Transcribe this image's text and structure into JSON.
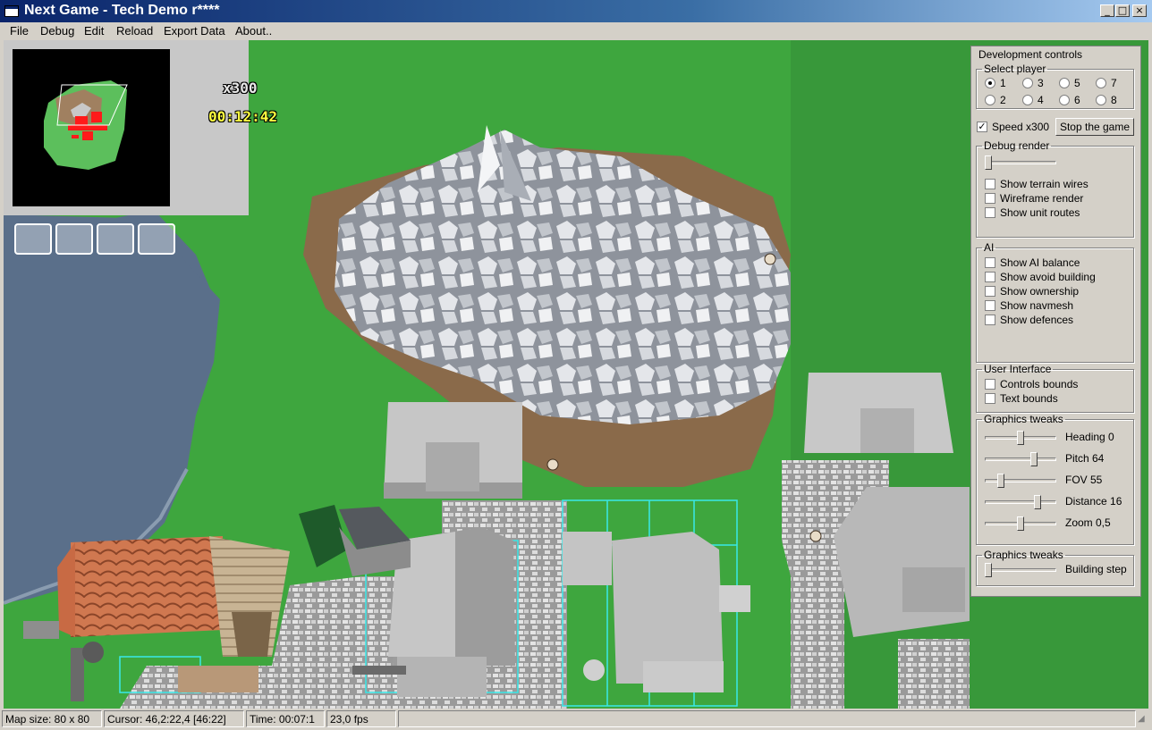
{
  "window": {
    "title": "Next Game - Tech Demo r****",
    "minimize": "_",
    "maximize": "□",
    "close": "×"
  },
  "menu": {
    "items": [
      "File",
      "Debug",
      "Edit",
      "Reload",
      "Export Data",
      "About.."
    ]
  },
  "hud": {
    "speed": "x300",
    "clock": "00:12:42"
  },
  "dev": {
    "title": "Development controls",
    "select_player": {
      "label": "Select player",
      "options": [
        "1",
        "2",
        "3",
        "4",
        "5",
        "6",
        "7",
        "8"
      ],
      "selected": "1"
    },
    "speed": {
      "label": "Speed x300",
      "checked": true
    },
    "stop_button": "Stop the game",
    "debug_render": {
      "label": "Debug render",
      "level": 0,
      "checks": [
        "Show terrain wires",
        "Wireframe render",
        "Show unit routes"
      ]
    },
    "ai": {
      "label": "AI",
      "checks": [
        "Show AI balance",
        "Show avoid building",
        "Show ownership",
        "Show navmesh",
        "Show defences"
      ]
    },
    "ui": {
      "label": "User Interface",
      "checks": [
        "Controls bounds",
        "Text bounds"
      ]
    },
    "graphics": {
      "label": "Graphics tweaks",
      "sliders": [
        {
          "label": "Heading 0",
          "level": 0.5
        },
        {
          "label": "Pitch 64",
          "level": 0.71
        },
        {
          "label": "FOV 55",
          "level": 0.19
        },
        {
          "label": "Distance 16",
          "level": 0.76
        },
        {
          "label": "Zoom 0,5",
          "level": 0.5
        }
      ]
    },
    "graphics2": {
      "label": "Graphics tweaks",
      "slider_label": "Building step",
      "level": 0
    }
  },
  "status": {
    "map": "Map size: 80 x 80",
    "cursor": "Cursor: 46,2:22,4 [46:22]",
    "time": "Time: 00:07:1",
    "fps": "23,0 fps"
  },
  "colors": {
    "grass": "#3ea63e",
    "water": "#5a6f8a",
    "dirt": "#8a6a4a",
    "rock": "#b8bcc4",
    "hud_yellow": "#ffff40",
    "title_blue": "#0a246a"
  }
}
